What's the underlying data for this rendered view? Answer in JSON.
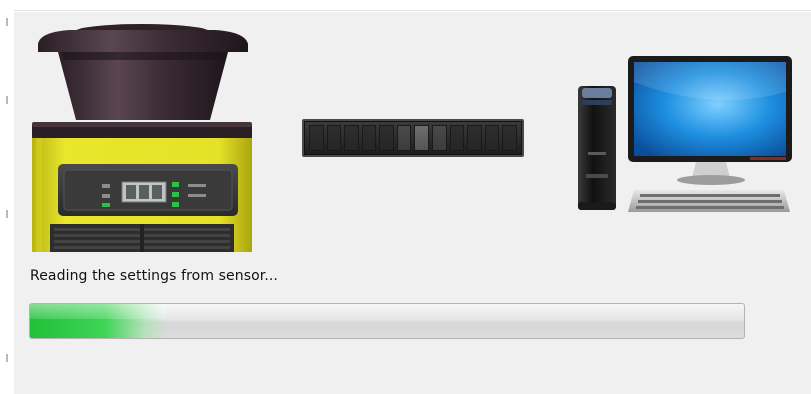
{
  "status": {
    "message": "Reading the settings from sensor..."
  },
  "progress": {
    "value": 0.19
  },
  "sensor": {
    "display_text": "?!?"
  },
  "colors": {
    "sensor_body": "#e3df2a",
    "sensor_head": "#3a2a33",
    "progress_fill": "#2ccb45",
    "screen_blue": "#1e8fe0"
  },
  "icons": [
    "laser-scanner-sensor-icon",
    "transfer-indicator-icon",
    "desktop-computer-icon"
  ]
}
